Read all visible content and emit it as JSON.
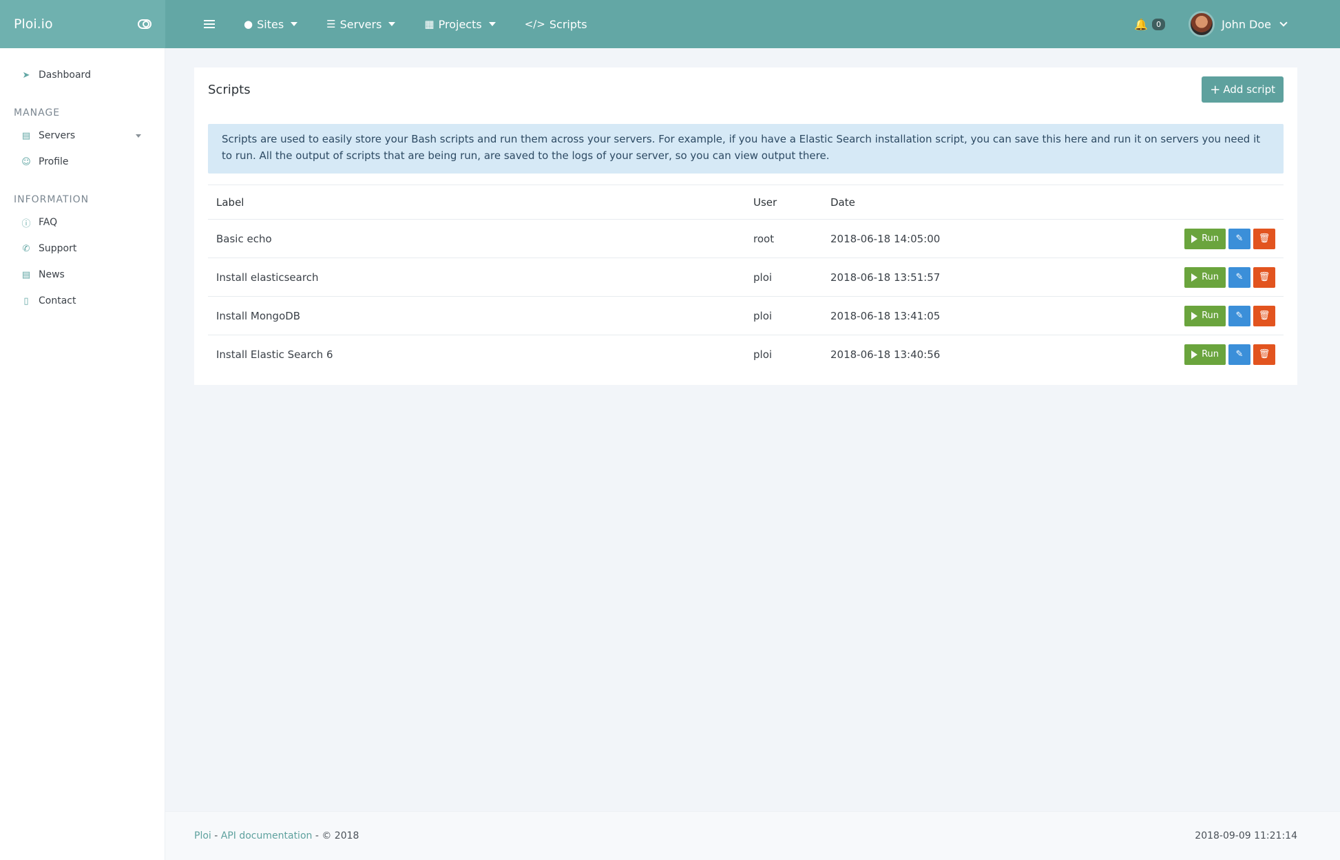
{
  "brand": {
    "name": "Ploi.io",
    "toggle_icon": "toggle-icon"
  },
  "topnav": {
    "items": [
      {
        "label": "Sites",
        "icon": "globe-icon",
        "has_dropdown": true
      },
      {
        "label": "Servers",
        "icon": "server-icon",
        "has_dropdown": true
      },
      {
        "label": "Projects",
        "icon": "sitemap-icon",
        "has_dropdown": true
      },
      {
        "label": "Scripts",
        "icon": "code-icon",
        "has_dropdown": false
      }
    ],
    "notifications_count": "0",
    "user_name": "John Doe"
  },
  "sidebar": {
    "dashboard": "Dashboard",
    "manage_heading": "MANAGE",
    "manage_items": [
      {
        "label": "Servers",
        "icon": "server-icon"
      },
      {
        "label": "Profile",
        "icon": "user-icon"
      }
    ],
    "information_heading": "INFORMATION",
    "information_items": [
      {
        "label": "FAQ",
        "icon": "question-icon"
      },
      {
        "label": "Support",
        "icon": "phone-icon"
      },
      {
        "label": "News",
        "icon": "newspaper-icon"
      },
      {
        "label": "Contact",
        "icon": "mobile-icon"
      }
    ]
  },
  "main": {
    "title": "Scripts",
    "add_button": "Add script",
    "info": "Scripts are used to easily store your Bash scripts and run them across your servers. For example, if you have a Elastic Search installation script, you can save this here and run it on servers you need it to run. All the output of scripts that are being run, are saved to the logs of your server, so you can view output there.",
    "table": {
      "headers": {
        "label": "Label",
        "user": "User",
        "date": "Date"
      },
      "run_label": "Run",
      "rows": [
        {
          "label": "Basic echo",
          "user": "root",
          "date": "2018-06-18 14:05:00"
        },
        {
          "label": "Install elasticsearch",
          "user": "ploi",
          "date": "2018-06-18 13:51:57"
        },
        {
          "label": "Install MongoDB",
          "user": "ploi",
          "date": "2018-06-18 13:41:05"
        },
        {
          "label": "Install Elastic Search 6",
          "user": "ploi",
          "date": "2018-06-18 13:40:56"
        }
      ]
    }
  },
  "footer": {
    "brand_link": "Ploi",
    "separator": " - ",
    "api_link": "API documentation",
    "copyright": " - © 2018",
    "timestamp": "2018-09-09 11:21:14"
  },
  "colors": {
    "topbar": "#63a7a5",
    "run": "#6aa43d",
    "edit": "#3b8fd9",
    "delete": "#e2541f",
    "alert": "#d6e9f6"
  }
}
